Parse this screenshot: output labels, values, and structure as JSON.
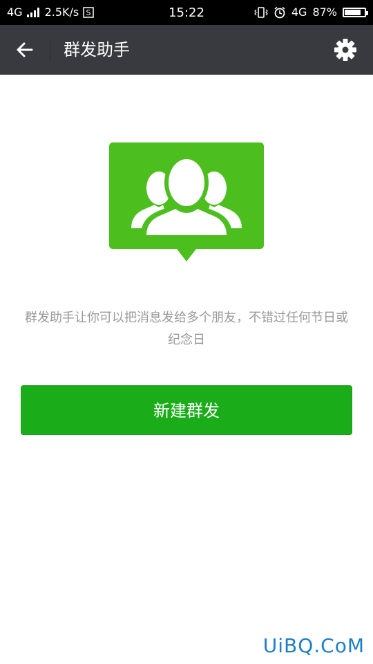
{
  "status_bar": {
    "network_left": "4G",
    "speed": "2.5K/s",
    "time": "15:22",
    "network_right": "4G",
    "battery_text": "87%",
    "battery_level": 0.87
  },
  "app_bar": {
    "title": "群发助手",
    "back_icon": "arrow-left-icon",
    "settings_icon": "gear-icon"
  },
  "hero": {
    "icon": "group-chat-icon",
    "color": "#4cbf1f"
  },
  "description": "群发助手让你可以把消息发给多个朋友，不错过任何节日或纪念日",
  "new_broadcast_button": "新建群发",
  "watermark": "UiBQ.CoM",
  "colors": {
    "app_bar": "#393a3f",
    "button": "#1aad19",
    "text_secondary": "#999999"
  }
}
